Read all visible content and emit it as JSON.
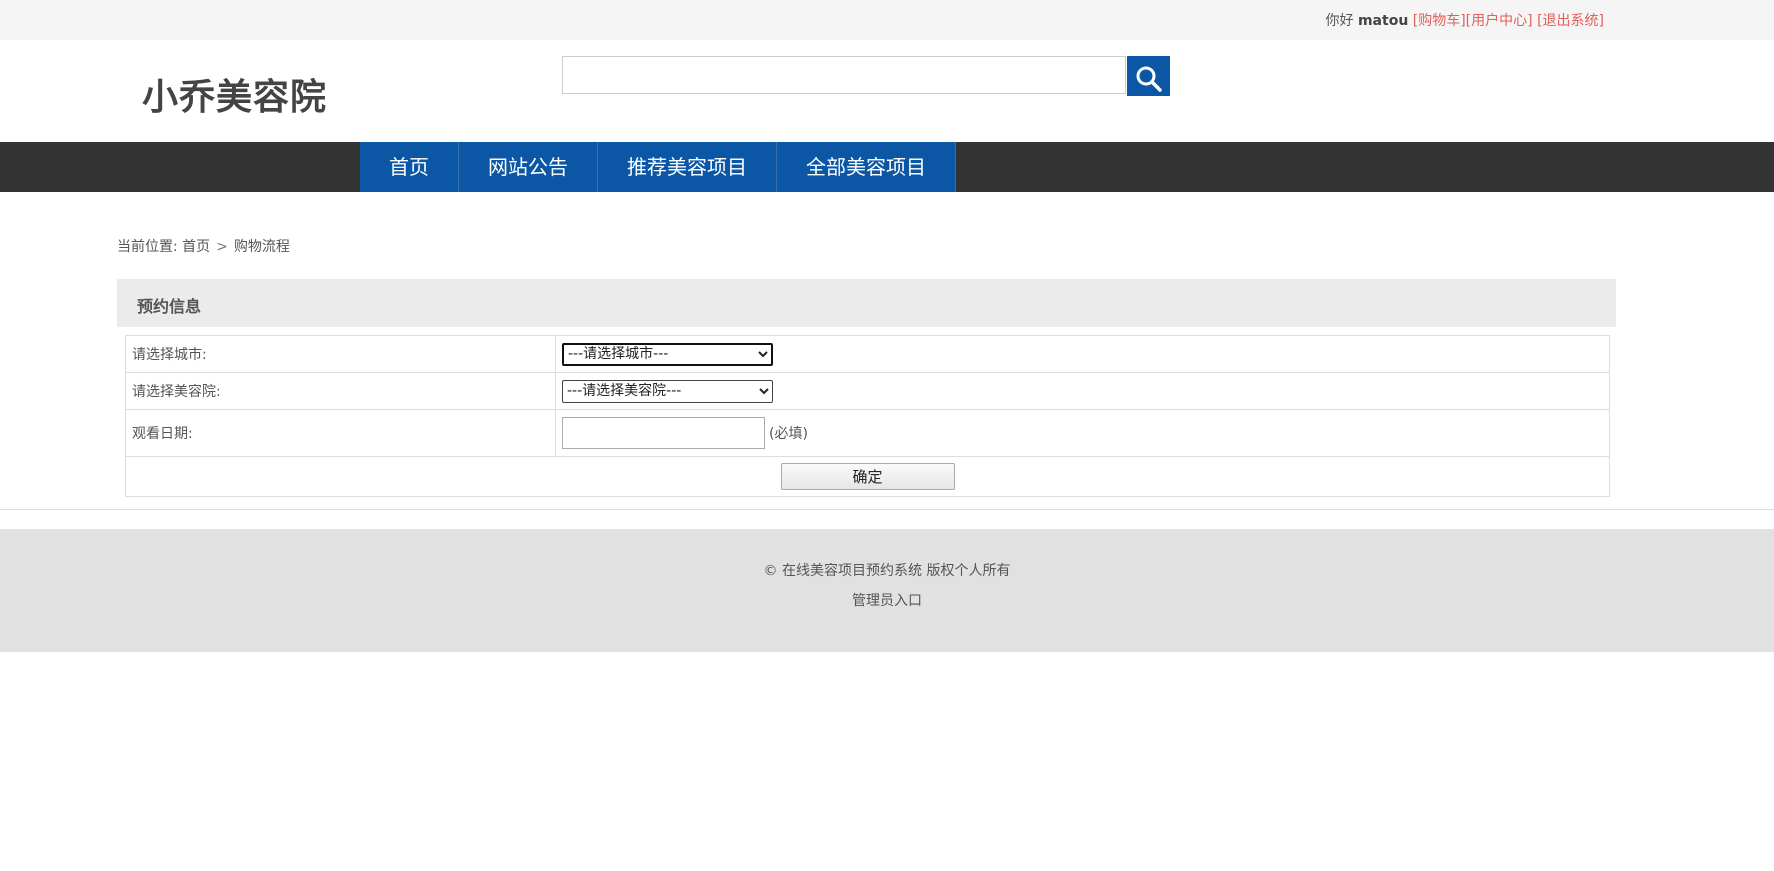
{
  "topbar": {
    "greeting": "你好",
    "username": "matou",
    "cart_link": "[购物车]",
    "user_center_link": "[用户中心]",
    "logout_link": "[退出系统]"
  },
  "header": {
    "logo_text": "小乔美容院",
    "search_icon": "search-icon"
  },
  "nav": {
    "items": [
      "首页",
      "网站公告",
      "推荐美容项目",
      "全部美容项目"
    ]
  },
  "breadcrumb": {
    "prefix": "当前位置:",
    "home": "首页",
    "separator": ">",
    "current": "购物流程"
  },
  "section": {
    "title": "预约信息"
  },
  "form": {
    "city_label": "请选择城市:",
    "city_selected": "---请选择城市---",
    "salon_label": "请选择美容院:",
    "salon_selected": "---请选择美容院---",
    "date_label": "观看日期:",
    "date_value": "",
    "date_required": "(必填)",
    "submit_label": "确定"
  },
  "footer": {
    "copyright": "© 在线美容项目预约系统 版权个人所有",
    "admin_link": "管理员入口"
  },
  "colors": {
    "primary_blue": "#0b57a6",
    "nav_dark": "#333333",
    "link_red": "#e0605a"
  }
}
